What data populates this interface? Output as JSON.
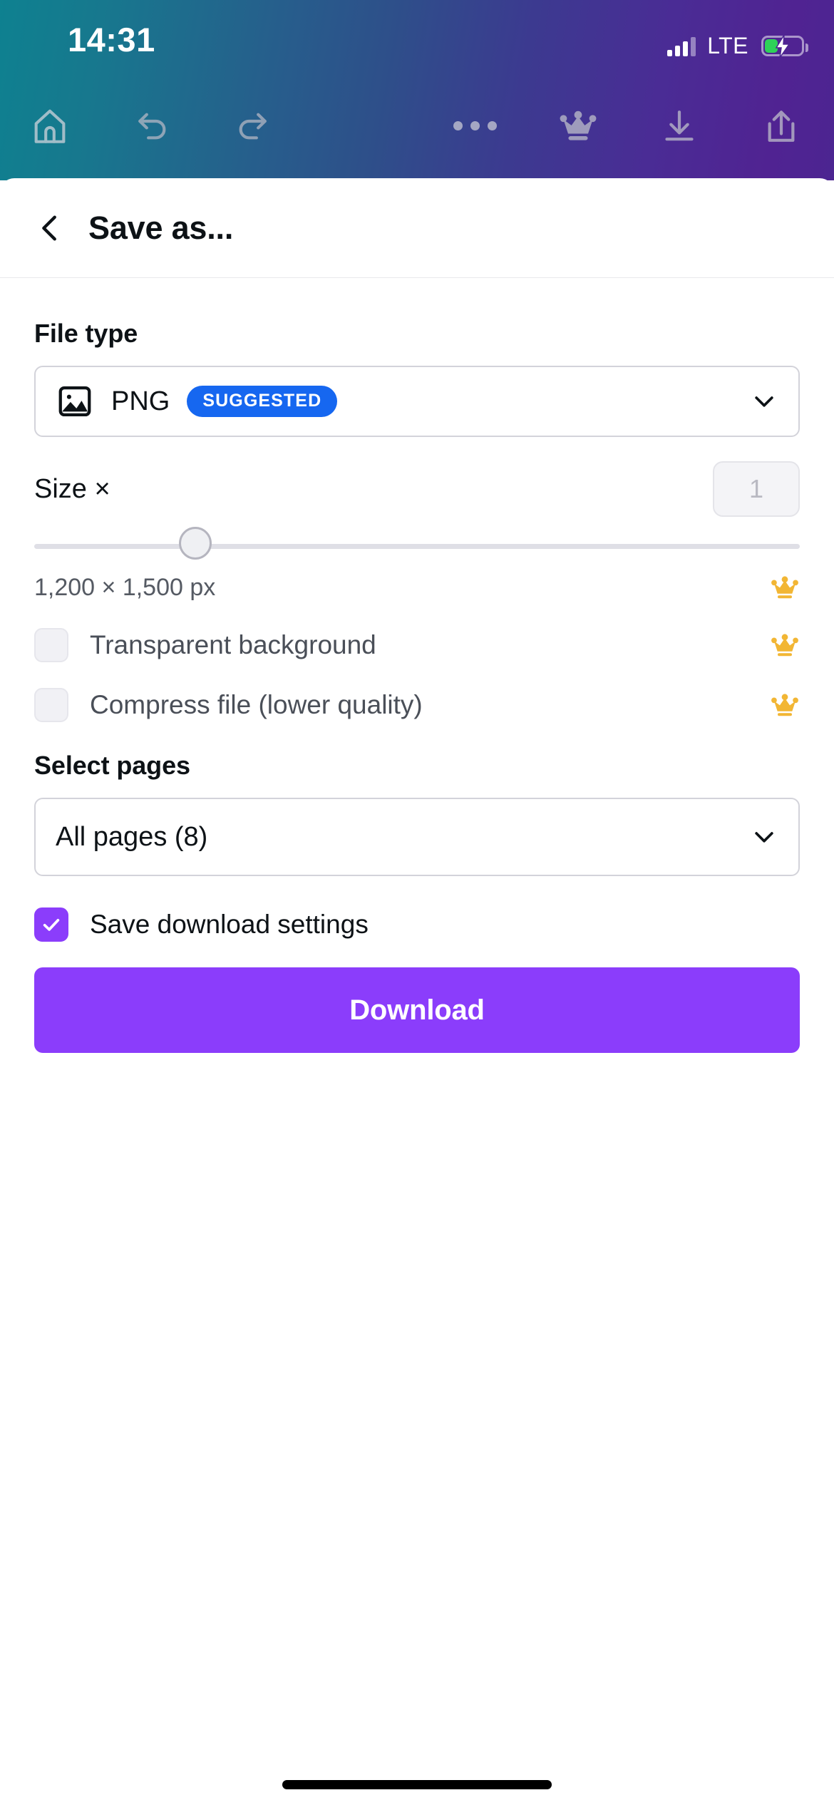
{
  "status_bar": {
    "time": "14:31",
    "network_label": "LTE",
    "signal_icon": "signal-bars-icon",
    "signal_bars_filled": 3,
    "signal_bars_total": 4,
    "battery_icon": "battery-charging-icon",
    "battery_level_percent": 34,
    "battery_color": "#2ED158"
  },
  "toolbar": {
    "home_icon": "home-icon",
    "undo_icon": "undo-icon",
    "redo_icon": "redo-icon",
    "more_icon": "more-horizontal-icon",
    "crown_icon": "crown-icon",
    "download_icon": "download-icon",
    "share_icon": "share-icon",
    "gradient_from": "#0E8190",
    "gradient_to": "#4C2591"
  },
  "header": {
    "back_icon": "chevron-left-icon",
    "title": "Save as..."
  },
  "file_type": {
    "label": "File type",
    "icon": "image-icon",
    "value": "PNG",
    "badge": "SUGGESTED",
    "badge_color": "#1667F0",
    "chevron_icon": "chevron-down-icon"
  },
  "size": {
    "label": "Size ×",
    "input_value": "1",
    "slider_percent": 21,
    "dimensions": "1,200 × 1,500 px",
    "crown_icon": "crown-icon",
    "crown_color": "#F2B634"
  },
  "options": [
    {
      "label": "Transparent background",
      "checked": false,
      "crown_icon": "crown-icon"
    },
    {
      "label": "Compress file (lower quality)",
      "checked": false,
      "crown_icon": "crown-icon"
    }
  ],
  "select_pages": {
    "label": "Select pages",
    "value": "All pages (8)",
    "chevron_icon": "chevron-down-icon"
  },
  "save_settings": {
    "label": "Save download settings",
    "checked": true,
    "check_icon": "checkmark-icon",
    "accent_color": "#8B3DFB"
  },
  "download_button": {
    "label": "Download",
    "color": "#8B3DFB"
  },
  "home_indicator": "home-indicator"
}
